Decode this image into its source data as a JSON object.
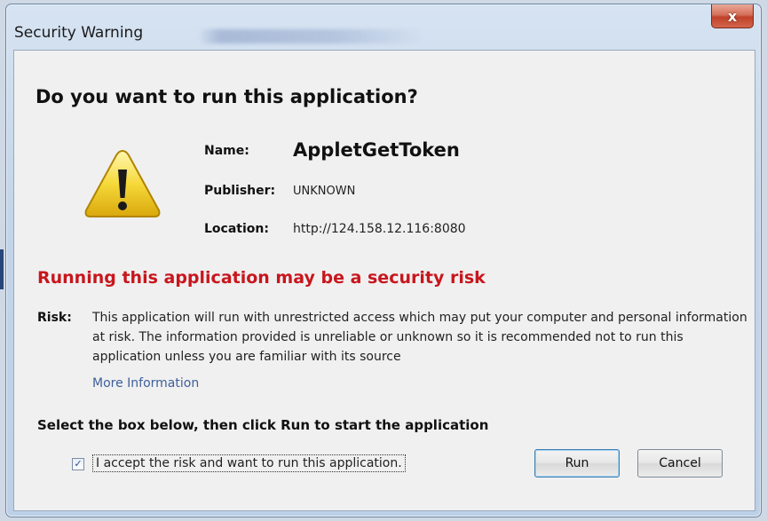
{
  "window": {
    "title": "Security Warning",
    "close_label": "x"
  },
  "dialog": {
    "heading": "Do you want to run this application?",
    "name_label": "Name:",
    "name_value": "AppletGetToken",
    "publisher_label": "Publisher:",
    "publisher_value": "UNKNOWN",
    "location_label": "Location:",
    "location_value": "http://124.158.12.116:8080",
    "risk_heading": "Running this application may be a security risk",
    "risk_label": "Risk:",
    "risk_text": "This application will run with unrestricted access which may put your computer and personal information at risk. The information provided is unreliable or unknown so it is recommended not to run this application unless you are familiar with its source",
    "more_info": "More Information",
    "instruction": "Select the box below, then click Run to start the application",
    "accept_checked": true,
    "accept_label": "I accept the risk and want to run this application.",
    "run_button": "Run",
    "cancel_button": "Cancel"
  },
  "icons": {
    "warning": "warning-triangle-icon",
    "close": "close-icon",
    "check": "check-icon"
  },
  "colors": {
    "risk_heading": "#c8161d",
    "link": "#3e5f9b",
    "close_button": "#c0412a"
  }
}
